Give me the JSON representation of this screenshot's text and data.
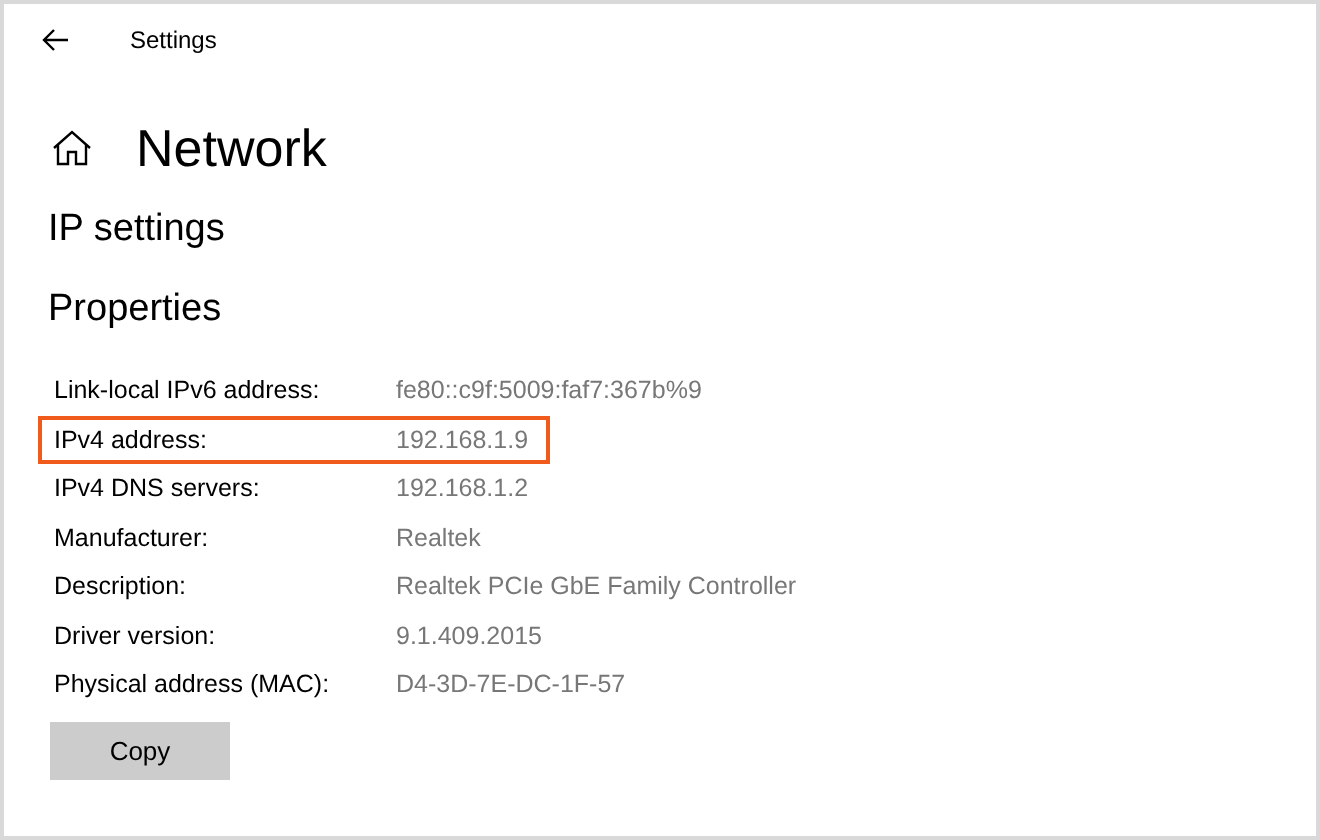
{
  "window": {
    "title": "Settings"
  },
  "page": {
    "title": "Network",
    "subtitle": "IP settings",
    "section": "Properties"
  },
  "properties": [
    {
      "label": "Link-local IPv6 address:",
      "value": "fe80::c9f:5009:faf7:367b%9",
      "highlighted": false
    },
    {
      "label": "IPv4 address:",
      "value": "192.168.1.9",
      "highlighted": true
    },
    {
      "label": "IPv4 DNS servers:",
      "value": "192.168.1.2",
      "highlighted": false
    },
    {
      "label": "Manufacturer:",
      "value": "Realtek",
      "highlighted": false
    },
    {
      "label": "Description:",
      "value": "Realtek PCIe GbE Family Controller",
      "highlighted": false
    },
    {
      "label": "Driver version:",
      "value": "9.1.409.2015",
      "highlighted": false
    },
    {
      "label": "Physical address (MAC):",
      "value": "D4-3D-7E-DC-1F-57",
      "highlighted": false
    }
  ],
  "buttons": [
    "Copy"
  ]
}
